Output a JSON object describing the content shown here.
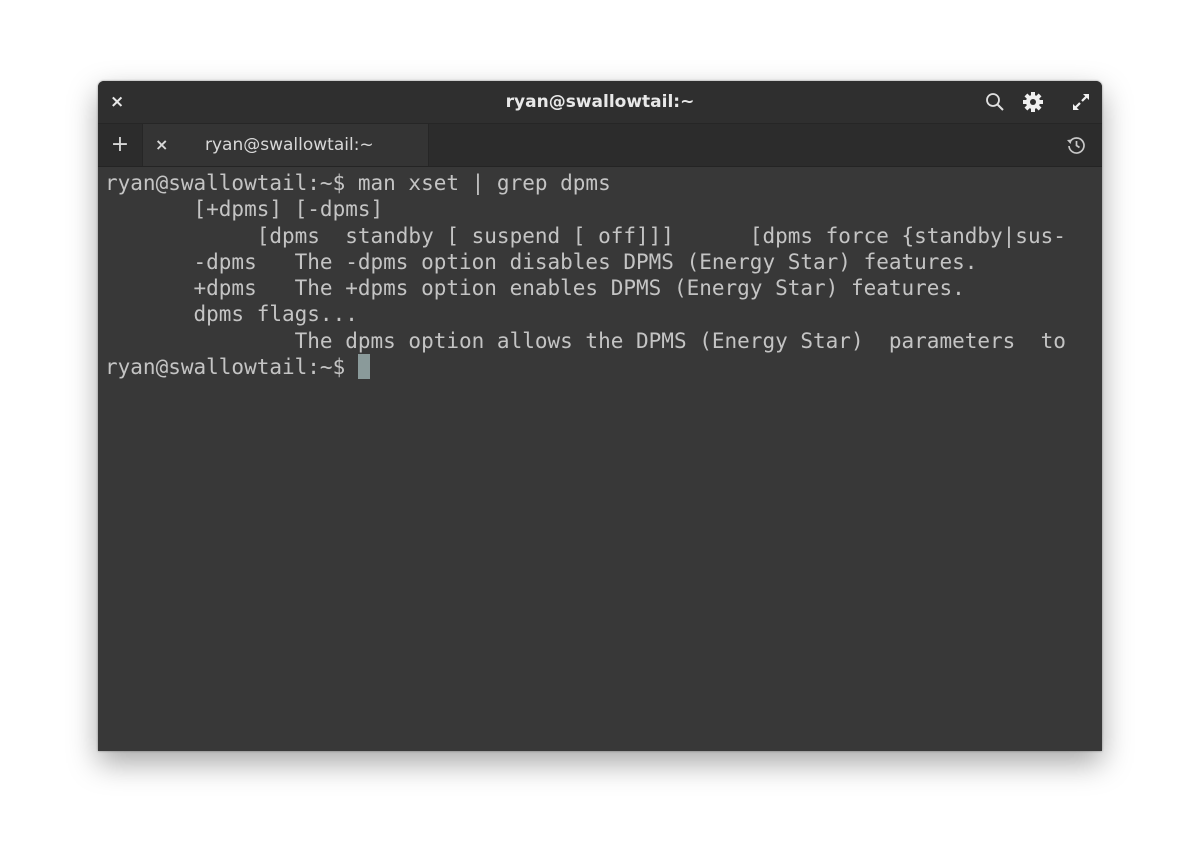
{
  "window": {
    "title": "ryan@swallowtail:~",
    "close_label": "×",
    "icons": [
      "search-icon",
      "gear-icon",
      "maximize-icon",
      "history-icon"
    ]
  },
  "tabs": {
    "new_tab_label": "+",
    "items": [
      {
        "label": "ryan@swallowtail:~",
        "close_label": "×"
      }
    ]
  },
  "terminal": {
    "lines": [
      "ryan@swallowtail:~$ man xset | grep dpms",
      "       [+dpms] [-dpms]",
      "            [dpms  standby [ suspend [ off]]]      [dpms force {standby|sus-",
      "       -dpms   The -dpms option disables DPMS (Energy Star) features.",
      "       +dpms   The +dpms option enables DPMS (Energy Star) features.",
      "       dpms flags...",
      "               The dpms option allows the DPMS (Energy Star)  parameters  to"
    ],
    "prompt": "ryan@swallowtail:~$ "
  },
  "colors": {
    "background": "#383838",
    "foreground": "#c4c4c4",
    "cursor": "#8a9a9a"
  }
}
